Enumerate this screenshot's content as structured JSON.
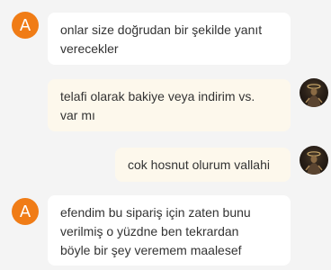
{
  "messages": [
    {
      "sender": "agent",
      "avatar_letter": "A",
      "lines": [
        "onlar size doğrudan bir şekilde yanıt",
        "verecekler"
      ]
    },
    {
      "sender": "user",
      "lines": [
        "telafi olarak bakiye veya indirim vs.",
        "var mı"
      ]
    },
    {
      "sender": "user",
      "lines": [
        "cok hosnut olurum vallahi"
      ]
    },
    {
      "sender": "agent",
      "avatar_letter": "A",
      "lines": [
        "efendim bu sipariş için zaten bunu",
        "verilmiş o yüzdne ben tekrardan",
        "böyle bir şey veremem maalesef"
      ]
    }
  ],
  "colors": {
    "background": "#f4f4f4",
    "agent_avatar": "#f07c16",
    "agent_bubble": "#ffffff",
    "user_bubble": "#fdf8ec",
    "text": "#333333"
  },
  "icons": {
    "agent_avatar": "letter-avatar",
    "user_avatar": "user-photo-avatar"
  }
}
